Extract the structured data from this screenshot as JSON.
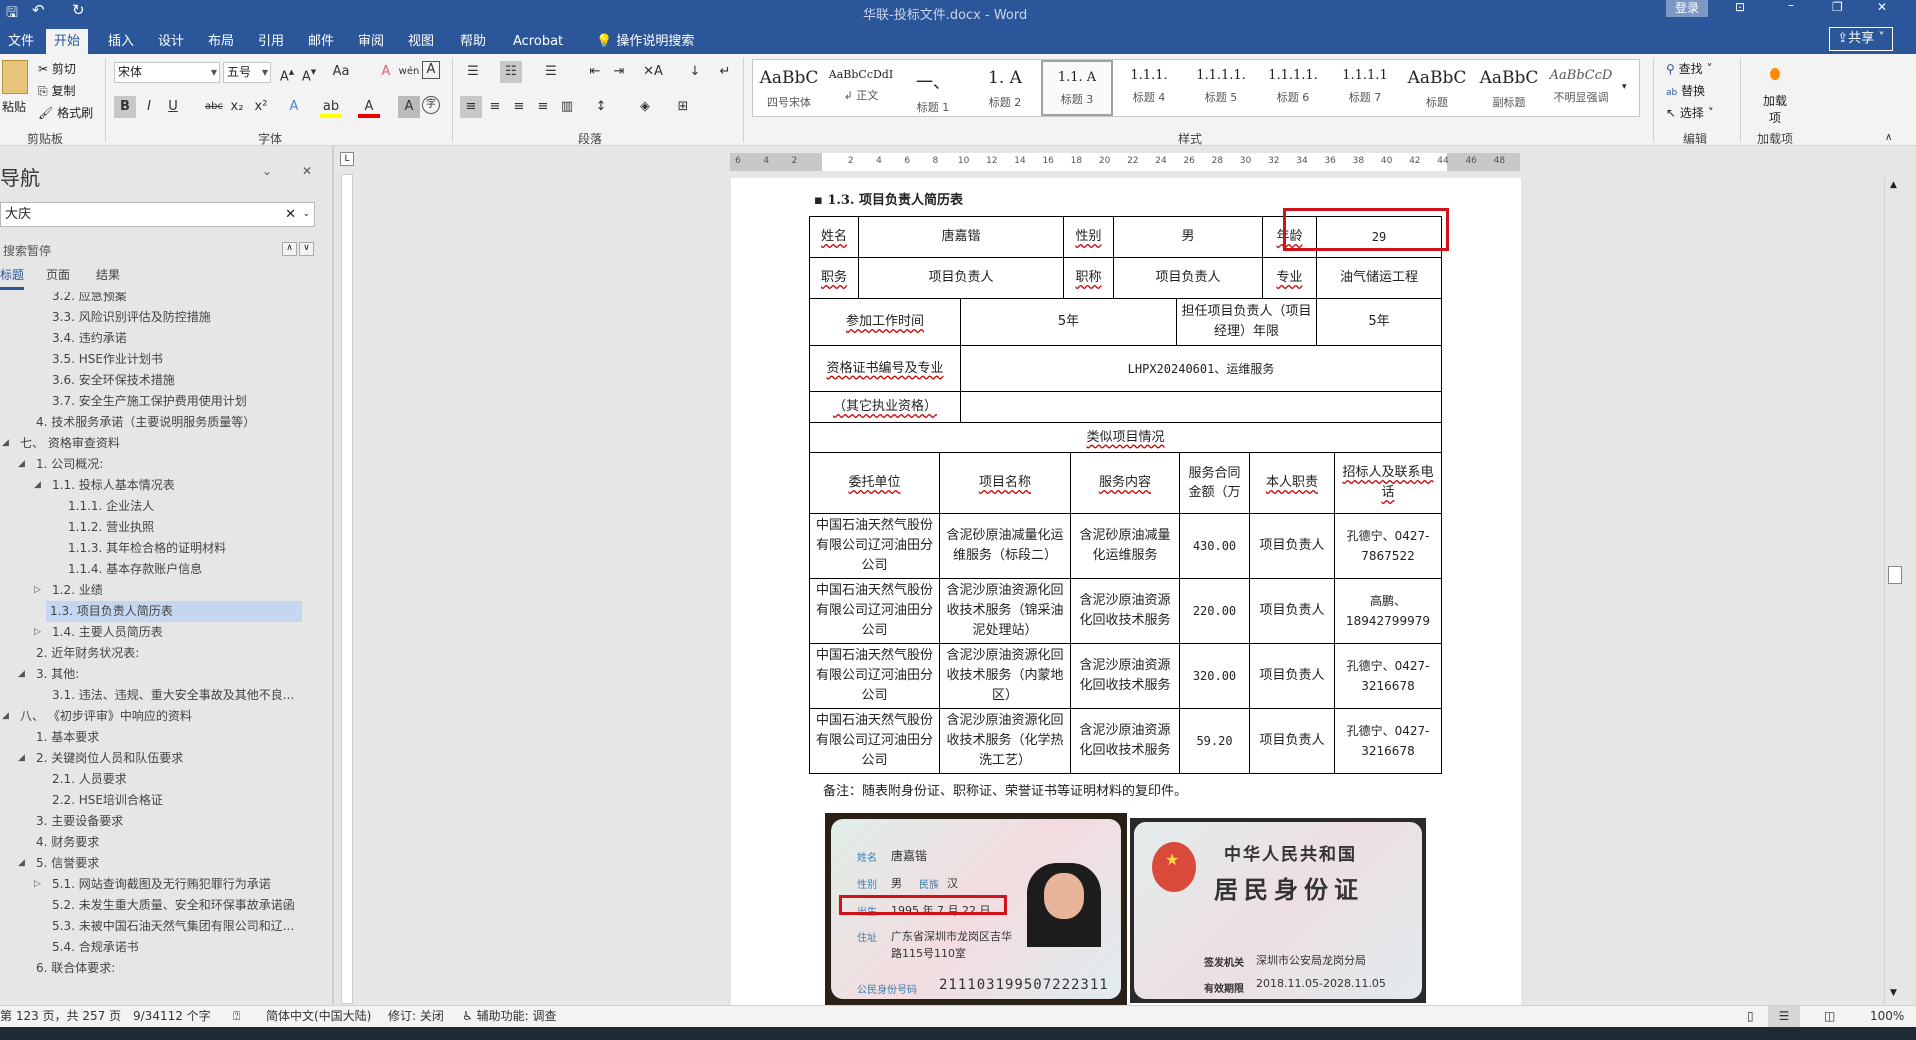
{
  "window": {
    "title": "华联-投标文件.docx - Word",
    "login": "登录",
    "share": "共享"
  },
  "tabs": [
    "文件",
    "开始",
    "插入",
    "设计",
    "布局",
    "引用",
    "邮件",
    "审阅",
    "视图",
    "帮助",
    "Acrobat"
  ],
  "active_tab": "开始",
  "tell_me": "操作说明搜索",
  "ribbon": {
    "clipboard": {
      "paste": "粘贴",
      "cut": "剪切",
      "copy": "复制",
      "format_painter": "格式刷",
      "label": "剪贴板"
    },
    "font": {
      "font_name": "宋体",
      "font_size": "五号",
      "label": "字体"
    },
    "paragraph": {
      "label": "段落"
    },
    "styles": {
      "label": "样式",
      "items": [
        {
          "preview": "AaBbC",
          "name": "四号宋体"
        },
        {
          "preview": "AaBbCcDdI",
          "name": "↲ 正文"
        },
        {
          "preview": "一、",
          "name": "标题 1"
        },
        {
          "preview": "1.  A",
          "name": "标题 2"
        },
        {
          "preview": "1.1.  A",
          "name": "标题 3",
          "selected": true
        },
        {
          "preview": "1.1.1.",
          "name": "标题 4"
        },
        {
          "preview": "1.1.1.1.",
          "name": "标题 5"
        },
        {
          "preview": "1.1.1.1.",
          "name": "标题 6"
        },
        {
          "preview": "1.1.1.1",
          "name": "标题 7"
        },
        {
          "preview": "AaBbC",
          "name": "标题"
        },
        {
          "preview": "AaBbC",
          "name": "副标题"
        },
        {
          "preview": "AaBbCcD",
          "name": "不明显强调"
        }
      ]
    },
    "editing": {
      "find": "查找",
      "replace": "替换",
      "select": "选择",
      "label": "编辑"
    },
    "addins": {
      "button": "加载项",
      "label": "加载项"
    }
  },
  "nav": {
    "title": "导航",
    "search_value": "大庆",
    "status": "搜索暂停",
    "tabs": [
      "标题",
      "页面",
      "结果"
    ],
    "active_tab": "标题",
    "items": [
      {
        "level": 2,
        "text": "3.2. 应急预案",
        "toggle": ""
      },
      {
        "level": 2,
        "text": "3.3. 风险识别评估及防控措施",
        "toggle": ""
      },
      {
        "level": 2,
        "text": "3.4. 违约承诺",
        "toggle": ""
      },
      {
        "level": 2,
        "text": "3.5. HSE作业计划书",
        "toggle": ""
      },
      {
        "level": 2,
        "text": "3.6. 安全环保技术措施",
        "toggle": ""
      },
      {
        "level": 2,
        "text": "3.7. 安全生产施工保护费用使用计划",
        "toggle": ""
      },
      {
        "level": 1,
        "text": "4. 技术服务承诺（主要说明服务质量等）",
        "toggle": ""
      },
      {
        "level": 0,
        "text": "七、 资格审查资料",
        "toggle": "◢"
      },
      {
        "level": 1,
        "text": "1. 公司概况:",
        "toggle": "◢"
      },
      {
        "level": 2,
        "text": "1.1. 投标人基本情况表",
        "toggle": "◢"
      },
      {
        "level": 3,
        "text": "1.1.1. 企业法人",
        "toggle": ""
      },
      {
        "level": 3,
        "text": "1.1.2. 营业执照",
        "toggle": ""
      },
      {
        "level": 3,
        "text": "1.1.3. 其年检合格的证明材料",
        "toggle": ""
      },
      {
        "level": 3,
        "text": "1.1.4. 基本存款账户信息",
        "toggle": ""
      },
      {
        "level": 2,
        "text": "1.2. 业绩",
        "toggle": "▷"
      },
      {
        "level": 2,
        "text": "1.3. 项目负责人简历表",
        "toggle": "",
        "selected": true
      },
      {
        "level": 2,
        "text": "1.4. 主要人员简历表",
        "toggle": "▷"
      },
      {
        "level": 1,
        "text": "2. 近年财务状况表:",
        "toggle": ""
      },
      {
        "level": 1,
        "text": "3. 其他:",
        "toggle": "◢"
      },
      {
        "level": 2,
        "text": "3.1. 违法、违规、重大安全事故及其他不良...",
        "toggle": ""
      },
      {
        "level": 0,
        "text": "八、 《初步评审》中响应的资料",
        "toggle": "◢"
      },
      {
        "level": 1,
        "text": "1. 基本要求",
        "toggle": ""
      },
      {
        "level": 1,
        "text": "2. 关键岗位人员和队伍要求",
        "toggle": "◢"
      },
      {
        "level": 2,
        "text": "2.1. 人员要求",
        "toggle": ""
      },
      {
        "level": 2,
        "text": "2.2. HSE培训合格证",
        "toggle": ""
      },
      {
        "level": 1,
        "text": "3. 主要设备要求",
        "toggle": ""
      },
      {
        "level": 1,
        "text": "4. 财务要求",
        "toggle": ""
      },
      {
        "level": 1,
        "text": "5. 信誉要求",
        "toggle": "◢"
      },
      {
        "level": 2,
        "text": "5.1. 网站查询截图及无行贿犯罪行为承诺",
        "toggle": "▷"
      },
      {
        "level": 2,
        "text": "5.2. 未发生重大质量、安全和环保事故承诺函",
        "toggle": ""
      },
      {
        "level": 2,
        "text": "5.3. 未被中国石油天然气集团有限公司和辽...",
        "toggle": ""
      },
      {
        "level": 2,
        "text": "5.4. 合规承诺书",
        "toggle": ""
      },
      {
        "level": 1,
        "text": "6. 联合体要求:",
        "toggle": ""
      }
    ]
  },
  "ruler": [
    "6",
    "4",
    "2",
    "",
    "2",
    "4",
    "6",
    "8",
    "10",
    "12",
    "14",
    "16",
    "18",
    "20",
    "22",
    "24",
    "26",
    "28",
    "30",
    "32",
    "34",
    "36",
    "38",
    "40",
    "42",
    "44",
    "46",
    "48"
  ],
  "doc": {
    "heading": "1.3. 项目负责人简历表",
    "r1": {
      "name_l": "姓名",
      "name": "唐嘉锴",
      "sex_l": "性别",
      "sex": "男",
      "age_l": "年龄",
      "age": "29"
    },
    "r2": {
      "duty_l": "职务",
      "duty": "项目负责人",
      "title_l": "职称",
      "title": "项目负责人",
      "major_l": "专业",
      "major": "油气储运工程"
    },
    "r3": {
      "work_l": "参加工作时间",
      "work": "5年",
      "pm_l": "担任项目负责人（项目经理）年限",
      "pm": "5年"
    },
    "r4": {
      "cert_l": "资格证书编号及专业",
      "cert": "LHPX20240601、运维服务"
    },
    "r5": {
      "other_l": "（其它执业资格）",
      "other": ""
    },
    "section": "类似项目情况",
    "headers": [
      "委托单位",
      "项目名称",
      "服务内容",
      "服务合同金额（万",
      "本人职责",
      "招标人及联系电话"
    ],
    "rows": [
      [
        "中国石油天然气股份有限公司辽河油田分公司",
        "含泥砂原油减量化运维服务（标段二）",
        "含泥砂原油减量化运维服务",
        "430.00",
        "项目负责人",
        "孔德宁、0427-7867522"
      ],
      [
        "中国石油天然气股份有限公司辽河油田分公司",
        "含泥沙原油资源化回收技术服务（锦采油泥处理站）",
        "含泥沙原油资源化回收技术服务",
        "220.00",
        "项目负责人",
        "高鹏、18942799979"
      ],
      [
        "中国石油天然气股份有限公司辽河油田分公司",
        "含泥沙原油资源化回收技术服务（内蒙地区）",
        "含泥沙原油资源化回收技术服务",
        "320.00",
        "项目负责人",
        "孔德宁、0427-3216678"
      ],
      [
        "中国石油天然气股份有限公司辽河油田分公司",
        "含泥沙原油资源化回收技术服务（化学热洗工艺）",
        "含泥沙原油资源化回收技术服务",
        "59.20",
        "项目负责人",
        "孔德宁、0427-3216678"
      ]
    ],
    "note": "备注：随表附身份证、职称证、荣誉证书等证明材料的复印件。",
    "id_front": {
      "name_l": "姓名",
      "name": "唐嘉锴",
      "sex_l": "性别",
      "sex": "男",
      "eth_l": "民族",
      "eth": "汉",
      "birth_l": "出生",
      "birth": "1995 年 7 月 22 日",
      "addr_l": "住址",
      "addr1": "广东省深圳市龙岗区吉华",
      "addr2": "路115号110室",
      "id_l": "公民身份号码",
      "id": "211103199507222311"
    },
    "id_back": {
      "country": "中华人民共和国",
      "card": "居民身份证",
      "auth_l": "签发机关",
      "auth": "深圳市公安局龙岗分局",
      "valid_l": "有效期限",
      "valid": "2018.11.05-2028.11.05"
    },
    "highlight_color": "#d0121b"
  },
  "status": {
    "page": "第 123 页，共 257 页",
    "words": "9/34112 个字",
    "lang": "简体中文(中国大陆)",
    "track": "修订: 关闭",
    "access": "辅助功能: 调查",
    "zoom": "100%"
  }
}
